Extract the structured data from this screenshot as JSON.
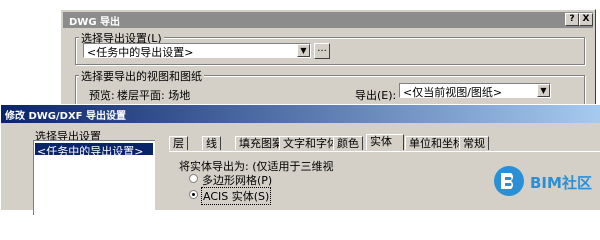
{
  "back_dialog": {
    "title": "DWG 导出",
    "help_label": "?",
    "close_label": "X",
    "export_setup_group": "选择导出设置(L)",
    "export_setup_value": "<任务中的导出设置>",
    "browse_label": "...",
    "views_group": "选择要导出的视图和图纸",
    "preview_label": "预览:",
    "preview_value": "楼层平面: 场地",
    "export_label": "导出(E):",
    "export_value": "<仅当前视图/图纸>"
  },
  "front_dialog": {
    "title": "修改 DWG/DXF 导出设置",
    "setup_group": "选择导出设置",
    "setup_item": "<任务中的导出设置>",
    "tabs": [
      "层",
      "线",
      "填充图案",
      "文字和字体",
      "颜色",
      "实体",
      "单位和坐标",
      "常规"
    ],
    "active_tab_index": 5,
    "solid_label": "将实体导出为: (仅适用于三维视",
    "options": [
      "多边形网格(P)",
      "ACIS 实体(S)"
    ],
    "selected_option_index": 1
  },
  "watermark": {
    "text": "BIM社区",
    "accent": "#2b8fd6"
  },
  "colors": {
    "dialog_bg": "#d4d0c8",
    "selected_bg": "#0a246a"
  }
}
